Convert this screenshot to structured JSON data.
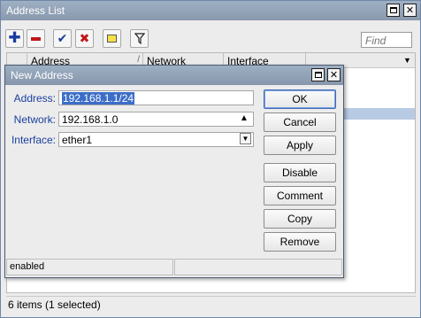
{
  "window": {
    "title": "Address List",
    "find_placeholder": "Find",
    "columns": [
      "Address",
      "Network",
      "Interface"
    ],
    "status": "6 items (1 selected)"
  },
  "toolbar": {
    "add_icon": "plus-icon",
    "remove_icon": "minus-icon",
    "enable_icon": "check-icon",
    "disable_icon": "x-icon",
    "comment_icon": "note-icon",
    "filter_icon": "filter-icon"
  },
  "dialog": {
    "title": "New Address",
    "fields": {
      "address": {
        "label": "Address:",
        "value": "192.168.1.1/24"
      },
      "network": {
        "label": "Network:",
        "value": "192.168.1.0"
      },
      "interface": {
        "label": "Interface:",
        "value": "ether1"
      }
    },
    "buttons": {
      "ok": "OK",
      "cancel": "Cancel",
      "apply": "Apply",
      "disable": "Disable",
      "comment": "Comment",
      "copy": "Copy",
      "remove": "Remove"
    },
    "status": "enabled"
  },
  "colors": {
    "titlebar": "#8f9fb5",
    "add": "#1a3a9c",
    "remove": "#c01818",
    "label": "#1a3fa0",
    "selection": "#3c6ec8"
  }
}
